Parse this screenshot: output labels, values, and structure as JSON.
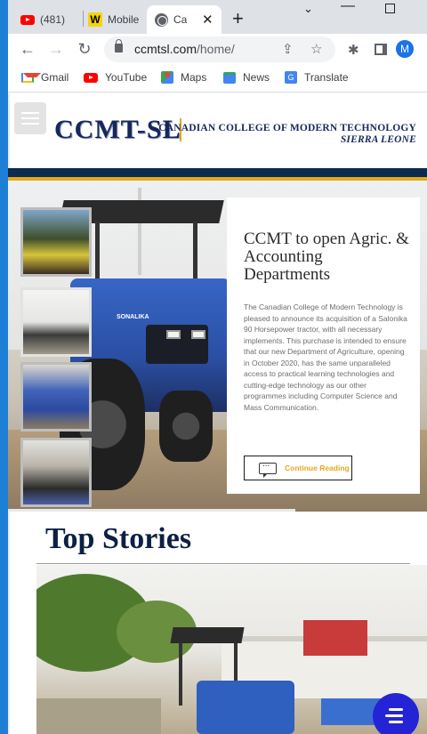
{
  "browser": {
    "tabs": [
      {
        "title": "(481)",
        "icon": "youtube-icon"
      },
      {
        "title": "Mobile",
        "icon": "w-icon"
      },
      {
        "title": "Ca",
        "icon": "globe-icon",
        "active": true
      }
    ],
    "url_domain": "ccmtsl.com",
    "url_path": "/home/",
    "profile_initial": "M",
    "bookmarks": [
      {
        "label": "Gmail",
        "icon": "gmail-icon"
      },
      {
        "label": "YouTube",
        "icon": "youtube-icon"
      },
      {
        "label": "Maps",
        "icon": "maps-icon"
      },
      {
        "label": "News",
        "icon": "news-icon"
      },
      {
        "label": "Translate",
        "icon": "translate-icon"
      }
    ]
  },
  "site": {
    "logo": "CCMT-SL",
    "college_name": "CANADIAN COLLEGE OF MODERN TECHNOLOGY",
    "location": "SIERRA LEONE",
    "colors": {
      "navy": "#0d2a4f",
      "gold": "#e2a91b",
      "chat": "#2424d6"
    }
  },
  "hero": {
    "tractor_brand": "SONALIKA",
    "title": "CCMT to open Agric. & Accounting Departments",
    "body": "The Canadian College of Modern Technology is pleased to announce its acquisition of a Salonika 90 Horsepower tractor, with all necessary implements. This purchase is intended to ensure that our new Department of Agriculture, opening in October 2020, has the same unparalleled access to practical learning technologies and cutting-edge technology as our other programmes including Computer Science and Mass Communication.",
    "cta": "Continue Reading"
  },
  "top_stories": {
    "heading": "Top Stories"
  }
}
